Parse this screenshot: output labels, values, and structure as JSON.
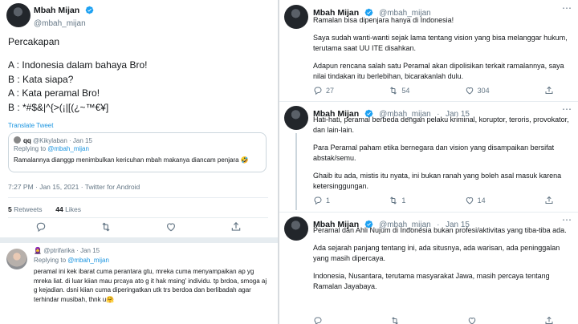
{
  "left": {
    "author": {
      "name": "Mbah Mijan",
      "handle": "@mbah_mijan"
    },
    "conversation": {
      "title": "Percakapan",
      "lines": [
        "A : Indonesia dalam bahaya Bro!",
        "B : Kata siapa?",
        "A : Kata peramal Bro!",
        "B : *#$&|^{>(¡|[(¿~™€¥]"
      ]
    },
    "translate_label": "Translate Tweet",
    "quote": {
      "name": "qq",
      "handle_date": "@Kikylaban · Jan 15",
      "replying_prefix": "Replying to ",
      "replying_to": "@mbah_mijan",
      "text": "Ramalannya dianggp menimbulkan kericuhan mbah makanya diancam penjara 🤣"
    },
    "timestamp": "7:27 PM · Jan 15, 2021 · Twitter for Android",
    "stats": {
      "retweets": "5",
      "retweets_label": "Retweets",
      "likes": "44",
      "likes_label": "Likes"
    },
    "reply": {
      "name": "🧕",
      "handle_date": "@ptrifarika · Jan 15",
      "replying_prefix": "Replying to ",
      "replying_to": "@mbah_mijan",
      "text": "peramal ini kek ibarat cuma perantara gtu, mreka cuma menyampaikan ap yg mreka liat. di luar kiian mau prcaya ato g it hak msing' individu. tp brdoa, smoga aj g kejadian. dsni kiian cuma diperingatkan utk trs berdoa dan berlibadah agar terhindar musibah, thnk u🤗"
    }
  },
  "right": {
    "tweets": [
      {
        "name": "Mbah Mijan",
        "handle": "@mbah_mijan",
        "date": "",
        "paragraphs": [
          "Ramalan bisa dipenjara hanya di Indonesia!",
          "Saya sudah wanti-wanti sejak lama tentang vision yang bisa melanggar hukum, terutama saat UU ITE disahkan.",
          "Adapun rencana salah satu Peramal akan dipolisikan terkait ramalannya, saya nilai tindakan itu berlebihan, bicarakanlah dulu."
        ],
        "replies": "27",
        "retweets": "54",
        "likes": "304"
      },
      {
        "name": "Mbah Mijan",
        "handle": "@mbah_mijan",
        "date": "Jan 15",
        "paragraphs": [
          "Hati-hati, peramal berbeda dengan pelaku kriminal, koruptor, teroris, provokator, dan lain-lain.",
          "Para Peramal paham etika bernegara dan vision yang disampaikan bersifat abstak/semu.",
          "Ghaib itu ada, mistis itu nyata, ini bukan ranah yang boleh asal masuk karena ketersinggungan."
        ],
        "replies": "1",
        "retweets": "1",
        "likes": "14"
      },
      {
        "name": "Mbah Mijan",
        "handle": "@mbah_mijan",
        "date": "Jan 15",
        "paragraphs": [
          "Peramal dan Ahli Nujum di Indonesia bukan profesi/aktivitas yang tiba-tiba ada.",
          "Ada sejarah panjang tentang ini, ada situsnya, ada warisan, ada peninggalan yang masih dipercaya.",
          "Indonesia, Nusantara, terutama masyarakat Jawa, masih percaya tentang Ramalan Jayabaya."
        ],
        "replies": "",
        "retweets": "",
        "likes": ""
      }
    ]
  },
  "colors": {
    "accent": "#1DA1F2",
    "muted": "#657786",
    "text": "#14171A",
    "border": "#E6ECF0"
  },
  "icons": [
    "verified-badge-icon",
    "reply-icon",
    "retweet-icon",
    "like-icon",
    "share-icon",
    "more-icon"
  ]
}
